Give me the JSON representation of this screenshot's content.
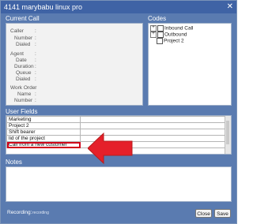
{
  "window": {
    "title": "4141 marybabu linux pro",
    "close_glyph": "✕"
  },
  "current_call": {
    "heading": "Current Call",
    "fields": [
      {
        "label": "Caller",
        "colon": ":"
      },
      {
        "label": "Number",
        "colon": ":"
      },
      {
        "label": "Dialed",
        "colon": ":"
      },
      {
        "label": "Agent",
        "colon": ":"
      },
      {
        "label": "Date",
        "colon": ":"
      },
      {
        "label": "Duration",
        "colon": ":"
      },
      {
        "label": "Queue",
        "colon": ":"
      },
      {
        "label": "Dialed",
        "colon": ":"
      },
      {
        "label": "Work Order",
        "colon": ":"
      },
      {
        "label": "Name",
        "colon": ":"
      },
      {
        "label": "Number",
        "colon": ":"
      }
    ]
  },
  "codes": {
    "heading": "Codes",
    "items": [
      {
        "label": "Inbound Call",
        "expander": "+"
      },
      {
        "label": "Outbound",
        "expander": "+"
      },
      {
        "label": "Project 2",
        "expander": ""
      }
    ]
  },
  "user_fields": {
    "heading": "User Fields",
    "rows": [
      {
        "name": "Marketing",
        "value": ""
      },
      {
        "name": "Project 2",
        "value": ""
      },
      {
        "name": "Shift bearer",
        "value": ""
      },
      {
        "name": "lid of the project",
        "value": ""
      },
      {
        "name": "Call from a new customer",
        "value": ""
      }
    ],
    "highlight_color": "#d0021b"
  },
  "notes": {
    "heading": "Notes",
    "value": ""
  },
  "footer": {
    "recording_label": "Recording:",
    "recording_value": "recording",
    "close_label": "Close",
    "save_label": "Save"
  },
  "colors": {
    "frame": "#5a7bb0",
    "titlebar": "#3f63a5",
    "arrow": "#e5202a"
  }
}
